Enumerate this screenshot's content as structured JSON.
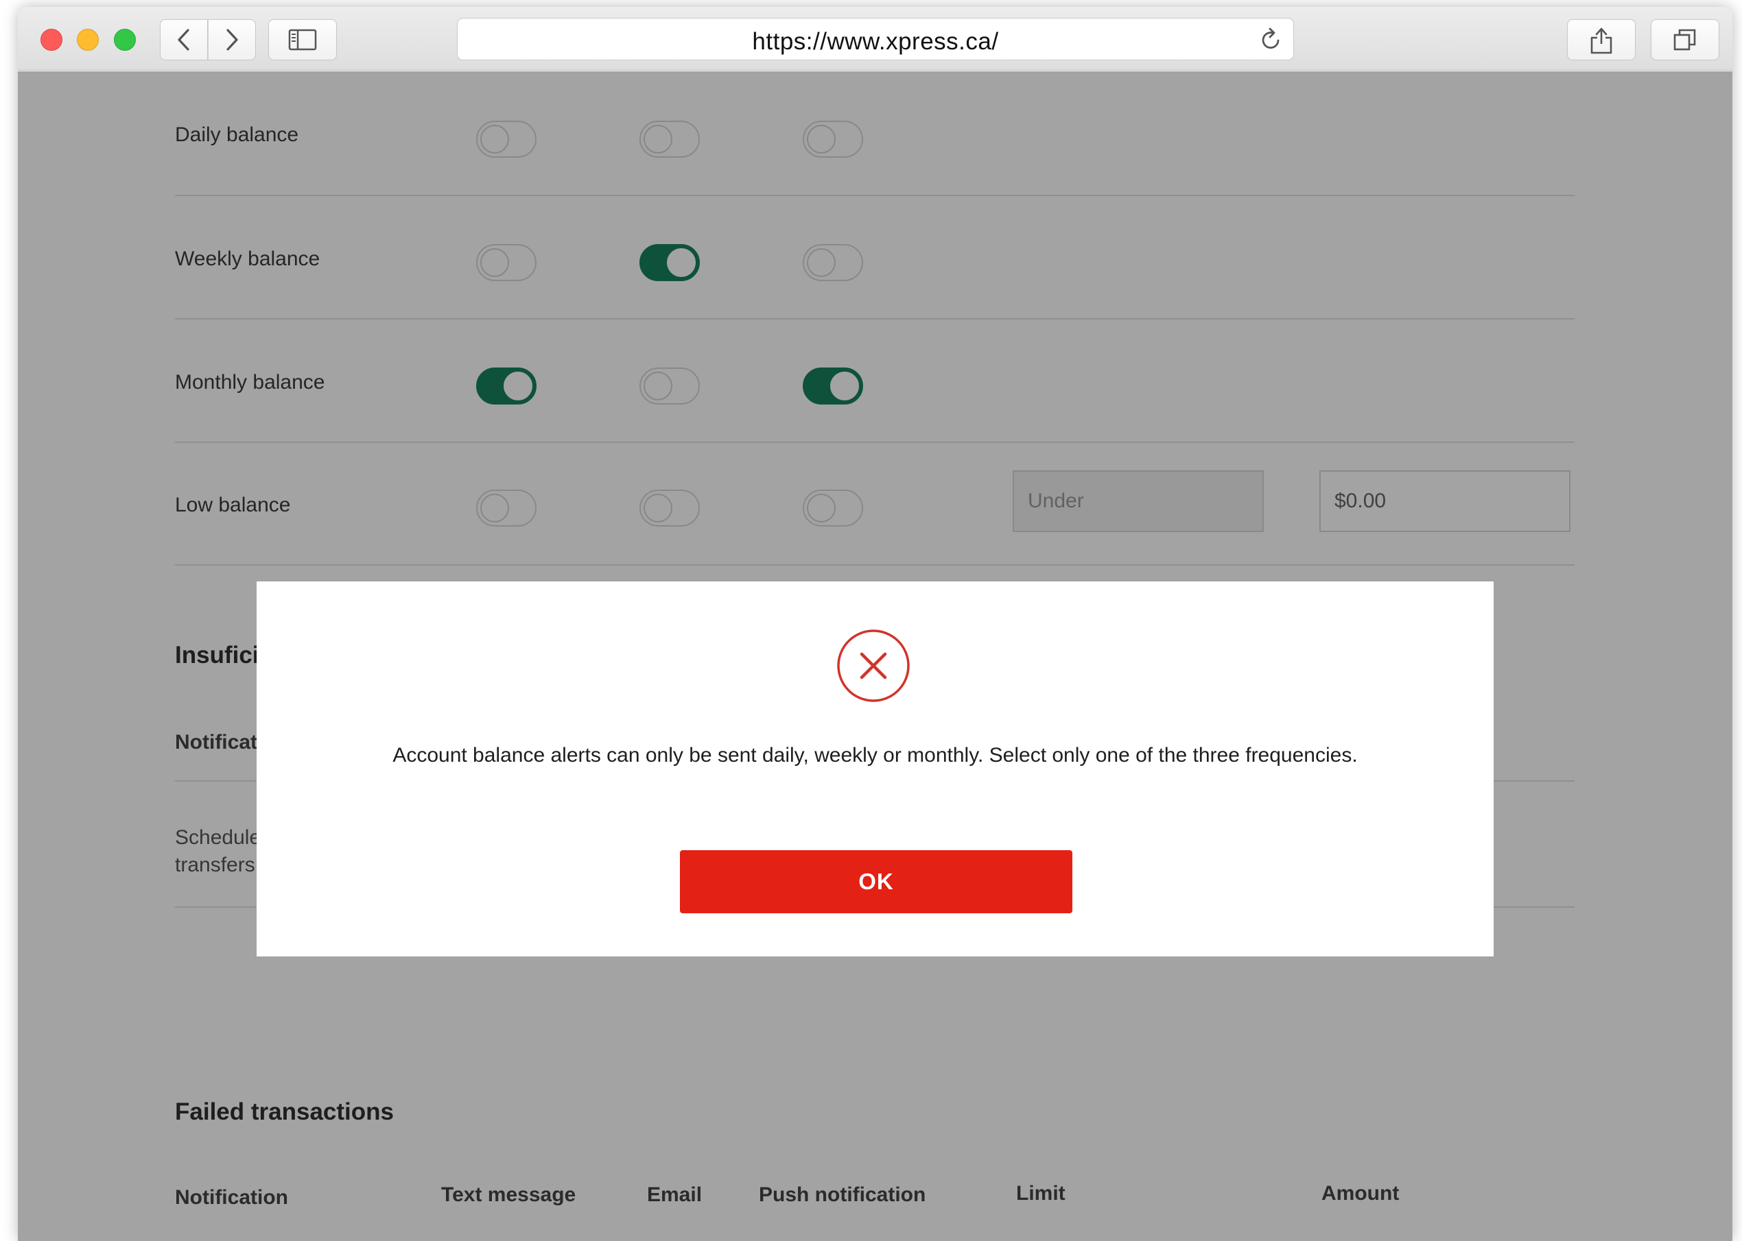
{
  "browser": {
    "url": "https://www.xpress.ca/"
  },
  "balance_alerts": {
    "rows": [
      {
        "label": "Daily balance",
        "toggles": [
          false,
          false,
          false
        ]
      },
      {
        "label": "Weekly balance",
        "toggles": [
          false,
          true,
          false
        ]
      },
      {
        "label": "Monthly balance",
        "toggles": [
          true,
          false,
          true
        ]
      },
      {
        "label": "Low balance",
        "toggles": [
          false,
          false,
          false
        ]
      }
    ],
    "low_balance_condition": "Under",
    "low_balance_amount": "$0.00"
  },
  "insufficient_section": {
    "title_fragment": "Insuficie",
    "notification_header_fragment": "Notificat",
    "scheduled_line1": "Schedule",
    "scheduled_line2": "transfers"
  },
  "failed_transactions": {
    "title": "Failed transactions",
    "columns": {
      "notification": "Notification",
      "text_message": "Text message",
      "email": "Email",
      "push": "Push notification",
      "limit": "Limit",
      "amount": "Amount"
    }
  },
  "modal": {
    "icon": "error-x-circle-icon",
    "message": "Account balance alerts can only be sent daily, weekly or monthly. Select only one of the three frequencies.",
    "ok_label": "OK"
  },
  "colors": {
    "toggle_on": "#17805e",
    "primary_button": "#e32114",
    "error_icon": "#d0342c"
  }
}
